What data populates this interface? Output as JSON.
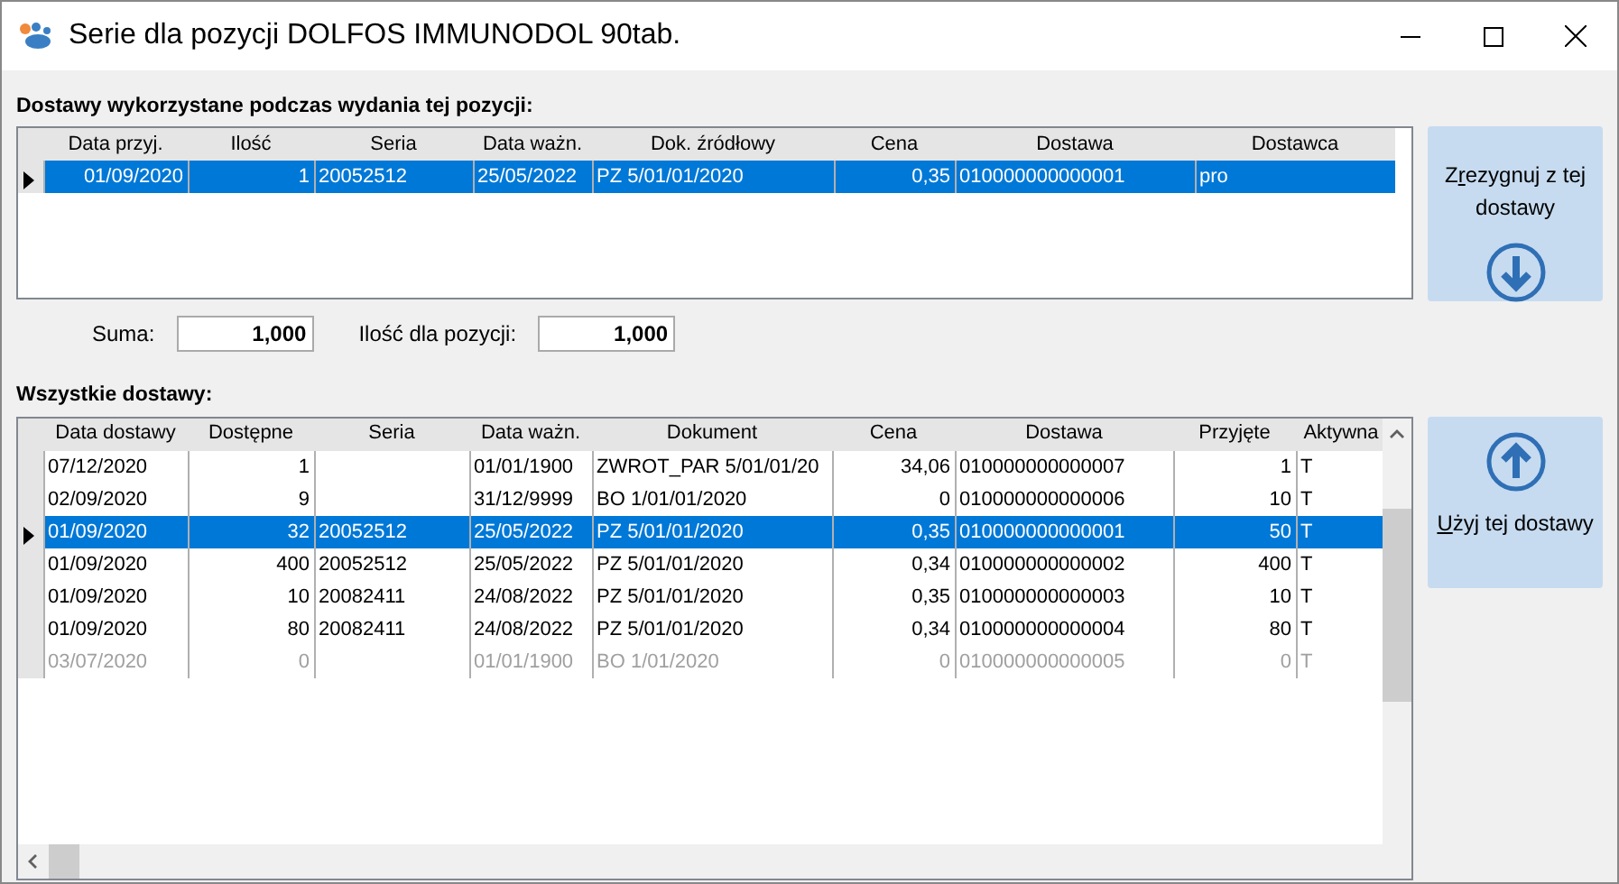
{
  "window": {
    "title": "Serie dla pozycji DOLFOS IMMUNODOL 90tab."
  },
  "used_deliveries": {
    "label": "Dostawy wykorzystane podczas wydania tej pozycji:",
    "columns": [
      {
        "label": "Data przyj."
      },
      {
        "label": "Ilość"
      },
      {
        "label": "Seria"
      },
      {
        "label": "Data ważn."
      },
      {
        "label": "Dok. źródłowy"
      },
      {
        "label": "Cena"
      },
      {
        "label": "Dostawa"
      },
      {
        "label": "Dostawca"
      }
    ],
    "rows": [
      {
        "selected": true,
        "cells": [
          "01/09/2020",
          "1",
          "20052512",
          "25/05/2022",
          "PZ 5/01/01/2020",
          "0,35",
          "010000000000001",
          "pro"
        ]
      }
    ]
  },
  "remove_button": {
    "label": "Zrezygnuj z tej dostawy"
  },
  "totals": [
    {
      "label": "Suma:",
      "value": "1,000"
    },
    {
      "label": "Ilość dla pozycji:",
      "value": "1,000"
    }
  ],
  "all_deliveries": {
    "label": "Wszystkie dostawy:",
    "columns": [
      {
        "label": "Data dostawy"
      },
      {
        "label": "Dostępne"
      },
      {
        "label": "Seria"
      },
      {
        "label": "Data ważn."
      },
      {
        "label": "Dokument"
      },
      {
        "label": "Cena"
      },
      {
        "label": "Dostawa"
      },
      {
        "label": "Przyjęte"
      },
      {
        "label": "Aktywna"
      }
    ],
    "rows": [
      {
        "selected": false,
        "inactive": false,
        "cells": [
          "07/12/2020",
          "1",
          "",
          "01/01/1900",
          "ZWROT_PAR 5/01/01/20",
          "34,06",
          "010000000000007",
          "1",
          "T"
        ]
      },
      {
        "selected": false,
        "inactive": false,
        "cells": [
          "02/09/2020",
          "9",
          "",
          "31/12/9999",
          "BO 1/01/01/2020",
          "0",
          "010000000000006",
          "10",
          "T"
        ]
      },
      {
        "selected": true,
        "inactive": false,
        "cells": [
          "01/09/2020",
          "32",
          "20052512",
          "25/05/2022",
          "PZ 5/01/01/2020",
          "0,35",
          "010000000000001",
          "50",
          "T"
        ]
      },
      {
        "selected": false,
        "inactive": false,
        "cells": [
          "01/09/2020",
          "400",
          "20052512",
          "25/05/2022",
          "PZ 5/01/01/2020",
          "0,34",
          "010000000000002",
          "400",
          "T"
        ]
      },
      {
        "selected": false,
        "inactive": false,
        "cells": [
          "01/09/2020",
          "10",
          "20082411",
          "24/08/2022",
          "PZ 5/01/01/2020",
          "0,35",
          "010000000000003",
          "10",
          "T"
        ]
      },
      {
        "selected": false,
        "inactive": false,
        "cells": [
          "01/09/2020",
          "80",
          "20082411",
          "24/08/2022",
          "PZ 5/01/01/2020",
          "0,34",
          "010000000000004",
          "80",
          "T"
        ]
      },
      {
        "selected": false,
        "inactive": true,
        "cells": [
          "03/07/2020",
          "0",
          "",
          "01/01/1900",
          "BO 1/01/2020",
          "0",
          "010000000000005",
          "0",
          "T"
        ]
      }
    ]
  },
  "use_button": {
    "label": "Użyj tej dostawy"
  }
}
